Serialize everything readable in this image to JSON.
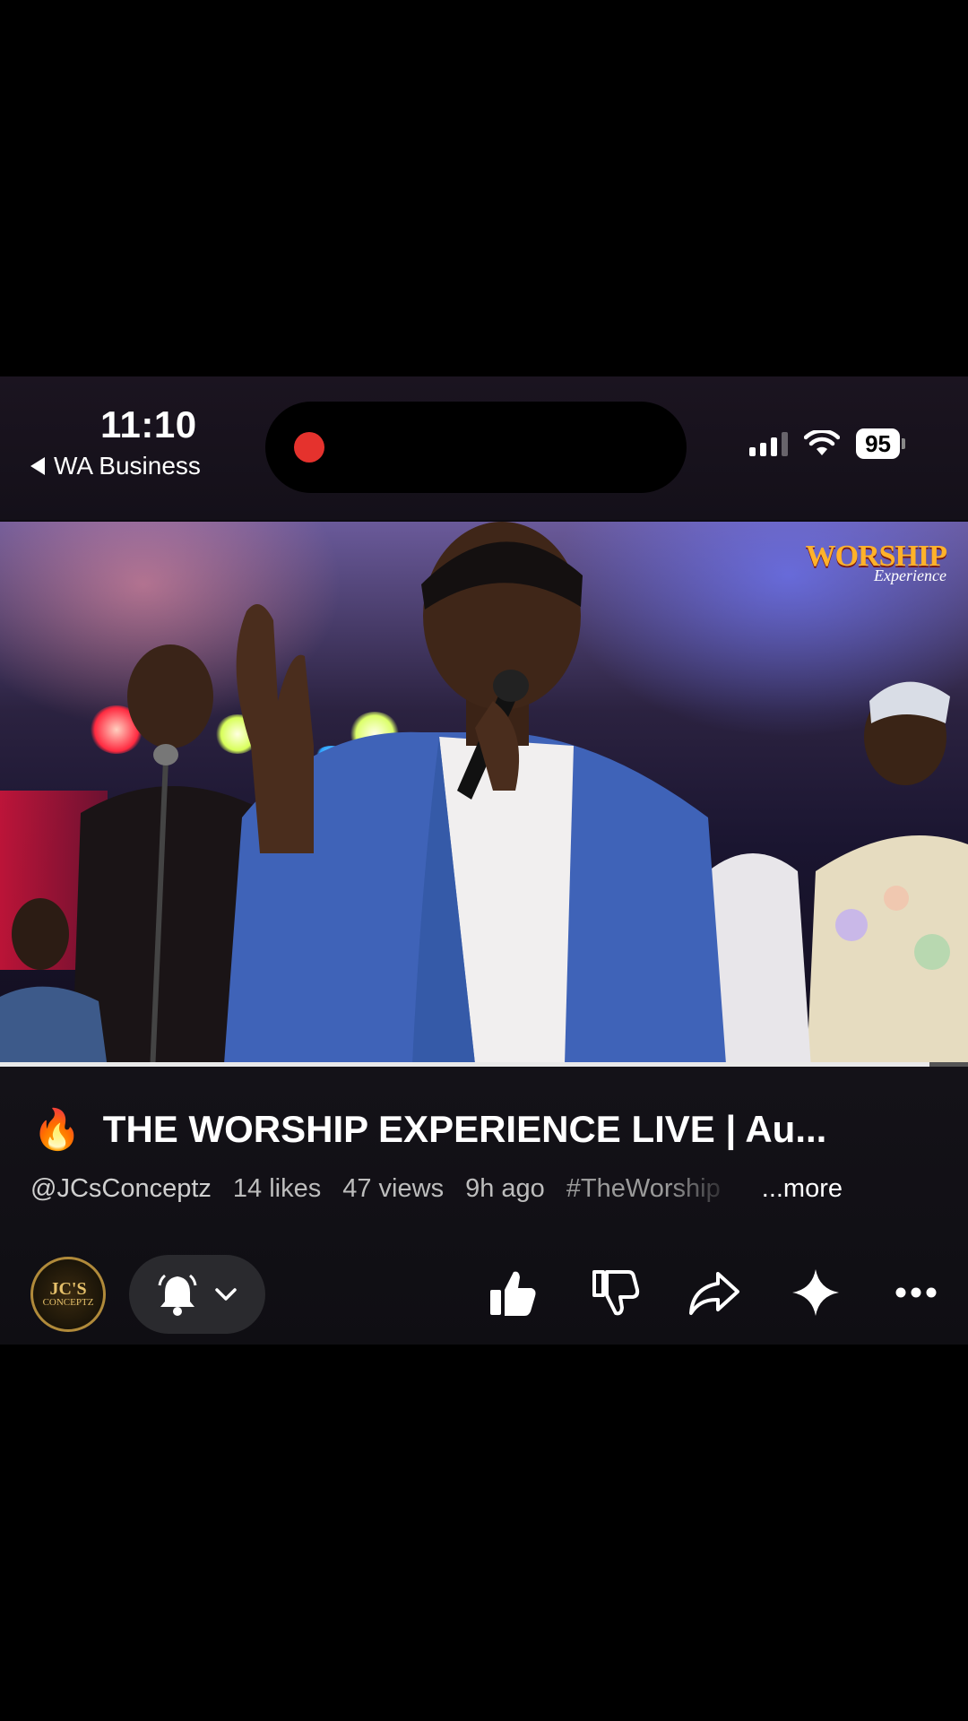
{
  "status_bar": {
    "time": "11:10",
    "back_app": "WA Business",
    "battery": "95",
    "recording_color": "#e5322d"
  },
  "video": {
    "watermark_line1": "WORSHIP",
    "watermark_line2": "Experience",
    "progress": 0.96
  },
  "info": {
    "title_emoji": "🔥",
    "title": "THE WORSHIP EXPERIENCE LIVE | Au...",
    "channel": "@JCsConceptz",
    "likes": "14 likes",
    "views": "47 views",
    "age": "9h ago",
    "hashtag": "#TheWorship",
    "more": "...more"
  },
  "channel_avatar": {
    "line1": "JC'S",
    "line2": "CONCEPTZ"
  },
  "actions": {
    "icons": [
      "bell-icon",
      "chevron-down-icon",
      "like-icon",
      "dislike-icon",
      "share-icon",
      "sparkle-icon",
      "more-icon"
    ]
  }
}
